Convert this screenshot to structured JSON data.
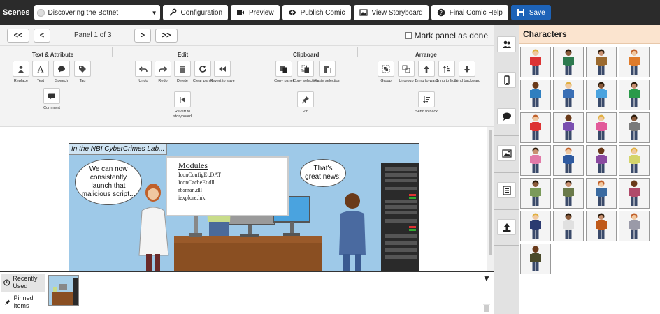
{
  "topbar": {
    "scenes_label": "Scenes",
    "scene_value": "Discovering the Botnet",
    "configuration": "Configuration",
    "preview": "Preview",
    "publish": "Publish Comic",
    "storyboard": "View Storyboard",
    "help": "Final Comic Help",
    "save": "Save"
  },
  "nav": {
    "first": "<<",
    "prev": "<",
    "panel_label": "Panel 1 of 3",
    "next": ">",
    "last": ">>",
    "mark_done": "Mark panel as done"
  },
  "toolbar": {
    "groups": {
      "text_attribute": "Text & Attribute",
      "edit": "Edit",
      "clipboard": "Clipboard",
      "arrange": "Arrange"
    },
    "tools": {
      "replace": "Replace",
      "text": "Text",
      "speech": "Speech",
      "tag": "Tag",
      "comment": "Comment",
      "undo": "Undo",
      "redo": "Redo",
      "delete": "Delete",
      "clear": "Clear panel",
      "revert_save": "Revert to save",
      "revert_storyboard": "Revert to storyboard",
      "copy_panel": "Copy panel",
      "copy_selection": "Copy selection",
      "paste_selection": "Paste selection",
      "pin": "Pin",
      "group": "Group",
      "ungroup": "Ungroup",
      "bring_forward": "Bring forward",
      "bring_front": "Bring to front",
      "send_backward": "Send backward",
      "send_back": "Send to back"
    }
  },
  "comic": {
    "caption": "In the NBI CyberCrimes Lab...",
    "bubble_left": "We can now consistently launch that malicious script...",
    "bubble_right": "That's great news!",
    "board_title": "Modules",
    "board_lines": [
      "IconConfigEt.DAT",
      "IconCacheEt.dll",
      "rbsman.dll",
      "iexplore.lnk"
    ]
  },
  "bottom": {
    "recent": "Recently Used",
    "pinned": "Pinned Items"
  },
  "characters": {
    "title": "Characters",
    "colors": {
      "shirts": [
        "#d33",
        "#2d7a4f",
        "#9b6a2f",
        "#e07b2a",
        "#2f7fc0",
        "#3a6fb5",
        "#4aa3df",
        "#2a9a4a",
        "#d33",
        "#7a4fb0",
        "#e25a9a",
        "#7a7a7a",
        "#e27aa8",
        "#2f5aa0",
        "#8a4aa0",
        "#d4d46a",
        "#7a9a5a",
        "#6a7a4a",
        "#3a6aa0",
        "#b04a6a",
        "#2b3a70",
        "#e0e0e0",
        "#c05a1a",
        "#9a9aa8",
        "#4a4a2a"
      ]
    }
  }
}
